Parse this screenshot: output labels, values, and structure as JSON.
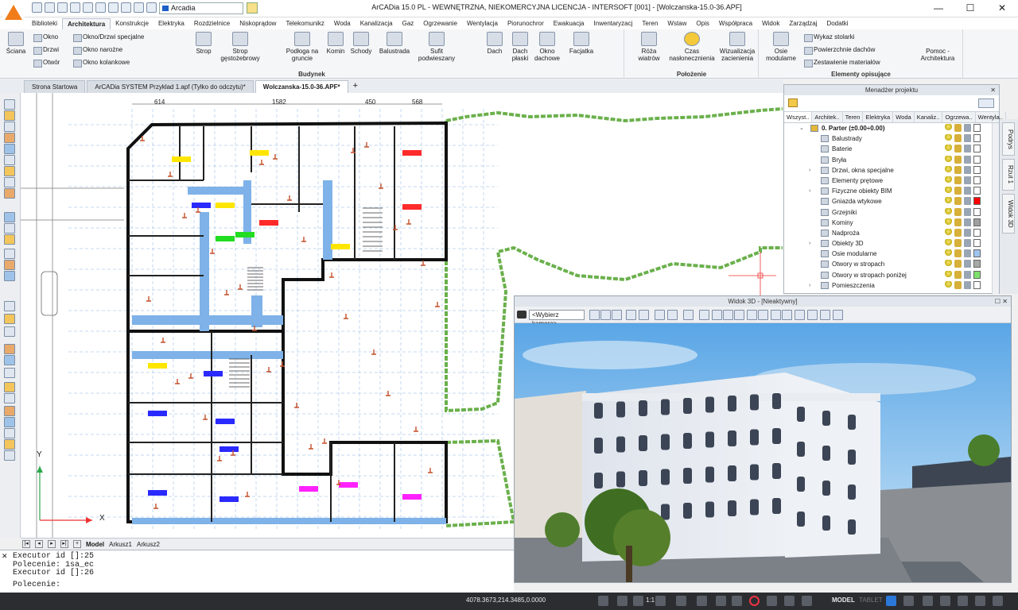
{
  "titlebar": {
    "title": "ArCADia 15.0 PL - WEWNĘTRZNA, NIEKOMERCYJNA LICENCJA - INTERSOFT [001] - [Wolczanska-15.0-36.APF]",
    "layer": "Arcadia",
    "min": "—",
    "max": "☐",
    "close": "✕"
  },
  "ribbon_tabs": [
    "Biblioteki",
    "Architektura",
    "Konstrukcje",
    "Elektryka",
    "Rozdzielnice",
    "Niskoprądow",
    "Telekomunikz",
    "Woda",
    "Kanalizacja",
    "Gaz",
    "Ogrzewanie",
    "Wentylacja",
    "Piorunochror",
    "Ewakuacja",
    "Inwentaryzacj",
    "Teren",
    "Wstaw",
    "Opis",
    "Współpraca",
    "Widok",
    "Zarządzaj",
    "Dodatki"
  ],
  "ribbon": {
    "wall": "Ściana",
    "okno": "Okno",
    "drzwi": "Drzwi",
    "otwor": "Otwór",
    "okno_drzwi": "Okno/Drzwi specjalne",
    "okno_narozne": "Okno narożne",
    "okno_kolankowe": "Okno kolankowe",
    "strop": "Strop",
    "strop_gesto": "Strop gęstożebrowy",
    "podloga": "Podłoga na gruncie",
    "komin": "Komin",
    "schody": "Schody",
    "balustrada": "Balustrada",
    "sufit": "Sufit podwieszany",
    "dach": "Dach",
    "dach_plaski": "Dach płaski",
    "okno_dachowe": "Okno dachowe",
    "facjatka": "Facjatka",
    "roza": "Róża wiatrów",
    "czas": "Czas nasłonecznienia",
    "wizualizacja": "Wizualizacja zacienienia",
    "osie": "Osie modularne",
    "wykaz": "Wykaz stolarki",
    "powierzchnie": "Powierzchnie dachów",
    "zestawienie": "Zestawienie materiałów",
    "pomoc": "Pomoc - Architektura",
    "group_budynek": "Budynek",
    "group_polozenie": "Położenie",
    "group_elementy": "Elementy opisujące"
  },
  "doc_tabs": [
    "Strona Startowa",
    "ArCADia SYSTEM Przyklad 1.apf (Tylko do odczytu)*",
    "Wolczanska-15.0-36.APF*"
  ],
  "dimensions": [
    "614",
    "1582",
    "450",
    "568"
  ],
  "drawing": {
    "axis_y": "Y",
    "axis_x": "X"
  },
  "sheet_tabs": [
    "Model",
    "Arkusz1",
    "Arkusz2"
  ],
  "command_lines": [
    "Executor id []:25",
    "Polecenie: 1sa_ec",
    "Executor id []:26"
  ],
  "command_prompt": "Polecenie:",
  "project_manager": {
    "title": "Menadżer projektu",
    "tabs": [
      "Wszyst..",
      "Architek..",
      "Teren",
      "Elektryka",
      "Woda",
      "Kanaliz..",
      "Ogrzewa..",
      "Wentyla.."
    ],
    "root": "0. Parter (±0.00÷0.00)",
    "items": [
      {
        "label": "Balustrady",
        "color": "#ffffff",
        "expand": false
      },
      {
        "label": "Baterie",
        "color": "#ffffff",
        "expand": false
      },
      {
        "label": "Bryła",
        "color": "#ffffff",
        "expand": false
      },
      {
        "label": "Drzwi, okna specjalne",
        "color": "#ffffff",
        "expand": true
      },
      {
        "label": "Elementy prętowe",
        "color": "#ffffff",
        "expand": false
      },
      {
        "label": "Fizyczne obiekty BIM",
        "color": "#ffffff",
        "expand": true
      },
      {
        "label": "Gniazda wtykowe",
        "color": "#ff0000",
        "expand": false
      },
      {
        "label": "Grzejniki",
        "color": "#ffffff",
        "expand": false
      },
      {
        "label": "Kominy",
        "color": "#a0a0a0",
        "expand": false
      },
      {
        "label": "Nadproża",
        "color": "#ffffff",
        "expand": false
      },
      {
        "label": "Obiekty 3D",
        "color": "#ffffff",
        "expand": true
      },
      {
        "label": "Osie modularne",
        "color": "#9fc5f0",
        "expand": false
      },
      {
        "label": "Otwory w stropach",
        "color": "#a8a8a8",
        "expand": false
      },
      {
        "label": "Otwory w stropach poniżej",
        "color": "#7de06a",
        "expand": false
      },
      {
        "label": "Pomieszczenia",
        "color": "#ffffff",
        "expand": true
      }
    ]
  },
  "side_tabs": [
    "Podrys",
    "Rzut 1",
    "Widok 3D"
  ],
  "view3d": {
    "title": "Widok 3D - [Nieaktywny]",
    "camera": "<Wybierz kamerę>"
  },
  "status": {
    "coords": "4078.3673,214.3485,0.0000",
    "scale": "1:1",
    "model": "MODEL",
    "tablet": "TABLET"
  }
}
